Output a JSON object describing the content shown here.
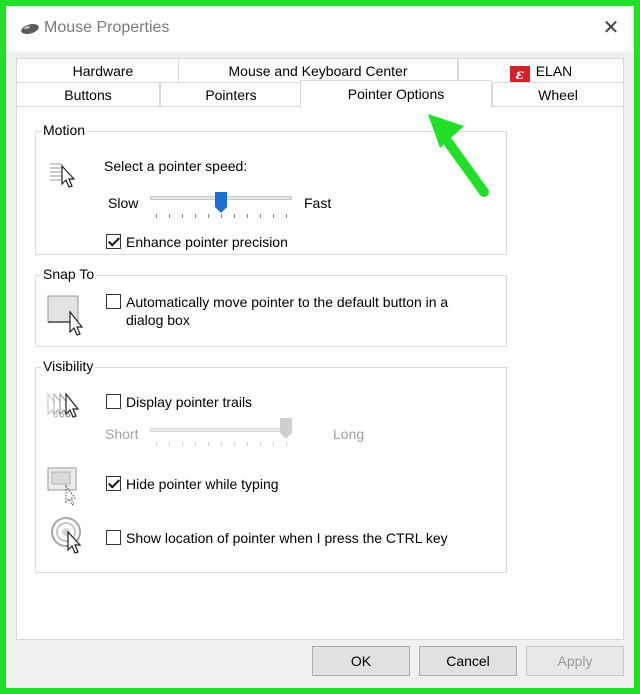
{
  "window": {
    "title": "Mouse Properties",
    "close_glyph": "✕",
    "title_icon": "mouse-icon"
  },
  "tabs": {
    "row1": [
      {
        "label": "Hardware"
      },
      {
        "label": "Mouse and Keyboard Center"
      },
      {
        "label": "ELAN",
        "icon": "elan-logo-icon",
        "logo_glyph": "ε"
      }
    ],
    "row2": [
      {
        "label": "Buttons"
      },
      {
        "label": "Pointers"
      },
      {
        "label": "Pointer Options",
        "active": true
      },
      {
        "label": "Wheel"
      }
    ]
  },
  "motion": {
    "title": "Motion",
    "speed_label": "Select a pointer speed:",
    "slow_label": "Slow",
    "fast_label": "Fast",
    "speed_value_fraction": 0.5,
    "enhance_precision_label": "Enhance pointer precision",
    "enhance_precision_checked": true,
    "icon": "pointer-speed-icon"
  },
  "snap_to": {
    "title": "Snap To",
    "auto_move_label_line1": "Automatically move pointer to the default button in a",
    "auto_move_label_line2": "dialog box",
    "auto_move_checked": false,
    "icon": "snap-to-icon"
  },
  "visibility": {
    "title": "Visibility",
    "trails_label": "Display pointer trails",
    "trails_checked": false,
    "short_label": "Short",
    "long_label": "Long",
    "trail_length_fraction": 1.0,
    "trail_slider_enabled": false,
    "hide_typing_label": "Hide pointer while typing",
    "hide_typing_checked": true,
    "ctrl_label": "Show location of pointer when I press the CTRL key",
    "ctrl_checked": false,
    "icons": [
      "pointer-trails-icon",
      "hide-pointer-icon",
      "pointer-location-icon"
    ]
  },
  "buttons": {
    "ok": "OK",
    "cancel": "Cancel",
    "apply": "Apply",
    "apply_enabled": false
  },
  "colors": {
    "frame_green": "#22e02a",
    "slider_thumb_blue": "#1f6fcf",
    "elan_red": "#d6202a"
  }
}
